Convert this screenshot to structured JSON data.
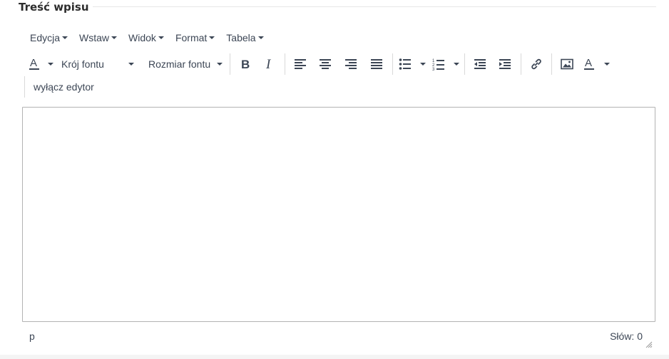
{
  "section": {
    "title": "Treść wpisu"
  },
  "menubar": {
    "items": [
      {
        "label": "Edycja"
      },
      {
        "label": "Wstaw"
      },
      {
        "label": "Widok"
      },
      {
        "label": "Format"
      },
      {
        "label": "Tabela"
      }
    ]
  },
  "toolbar": {
    "font_family_label": "Krój fontu",
    "font_size_label": "Rozmiar fontu",
    "toggle_editor_label": "wyłącz edytor"
  },
  "statusbar": {
    "path": "p",
    "word_count": "Słów: 0"
  },
  "colors": {
    "icon": "#3c4655",
    "border": "#b3b3b3",
    "separator": "#d9d9d9"
  }
}
